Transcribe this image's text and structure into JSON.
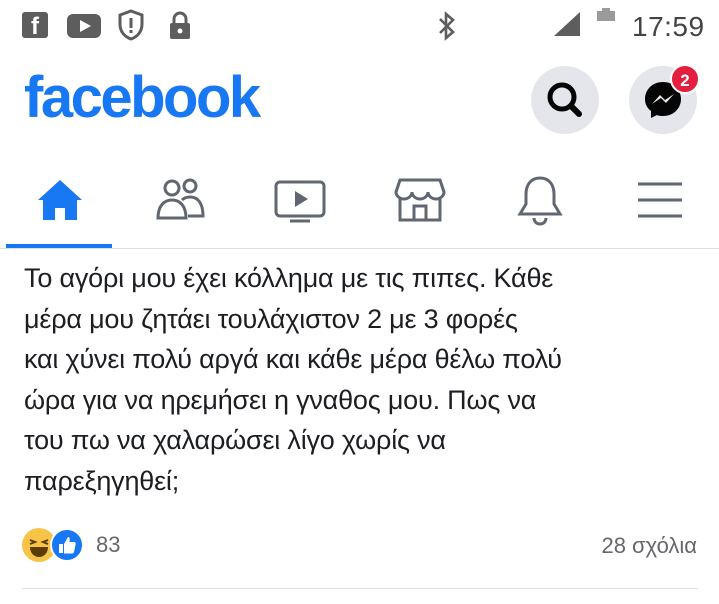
{
  "status_bar": {
    "time": "17:59",
    "fb_letter": "f",
    "icons": [
      "facebook-icon",
      "youtube-icon",
      "shield-icon",
      "lock-icon",
      "bluetooth-icon",
      "signal-icon",
      "battery-icon"
    ]
  },
  "header": {
    "logo": "facebook",
    "messenger_badge": "2",
    "brand_color": "#1877f2"
  },
  "tabs": [
    {
      "name": "home",
      "icon": "home-icon",
      "active": true
    },
    {
      "name": "friends",
      "icon": "friends-icon",
      "active": false
    },
    {
      "name": "watch",
      "icon": "video-icon",
      "active": false
    },
    {
      "name": "marketplace",
      "icon": "store-icon",
      "active": false
    },
    {
      "name": "notifications",
      "icon": "bell-icon",
      "active": false
    },
    {
      "name": "menu",
      "icon": "hamburger-icon",
      "active": false
    }
  ],
  "post": {
    "lines": [
      "Το αγόρι μου έχει κόλλημα με τις πιπες. Κάθε",
      "μέρα μου ζητάει τουλάχιστον 2 με 3 φορές",
      "και χύνει πολύ αργά και κάθε μέρα θέλω πολύ",
      "ώρα για να ηρεμήσει η γναθος μου.  Πως να",
      "του πω να χαλαρώσει λίγο χωρίς να",
      "παρεξηγηθεί;"
    ],
    "reaction_count": "83",
    "comments": "28 σχόλια"
  }
}
